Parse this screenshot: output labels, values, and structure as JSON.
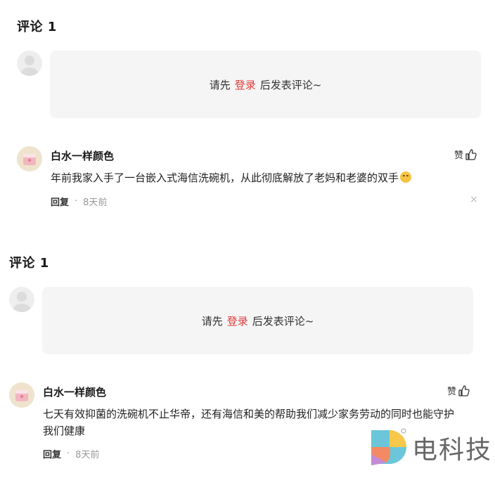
{
  "sections": [
    {
      "title": "评论 1",
      "login_prompt": {
        "before": "请先",
        "link": "登录",
        "after": "后发表评论~"
      },
      "comment": {
        "username": "白水一样颜色",
        "text": "年前我家入手了一台嵌入式海信洗碗机，从此彻底解放了老妈和老婆的双手",
        "emoji": "smirk-emoji",
        "like_label": "赞",
        "reply_label": "回复",
        "time": "8天前",
        "close_label": "×"
      }
    },
    {
      "title": "评论 1",
      "login_prompt": {
        "before": "请先",
        "link": "登录",
        "after": "后发表评论~"
      },
      "comment": {
        "username": "白水一样颜色",
        "text_line1": "七天有效抑菌的洗碗机不止华帝，还有海信和美的帮助我们减少家务劳动的同时也能守护",
        "text_line2": "我们健康",
        "like_label": "赞",
        "reply_label": "回复",
        "time": "8天前"
      }
    }
  ],
  "watermark": {
    "text": "电科技"
  },
  "colors": {
    "accent": "#e33b3b",
    "box_bg": "#f5f5f5"
  }
}
